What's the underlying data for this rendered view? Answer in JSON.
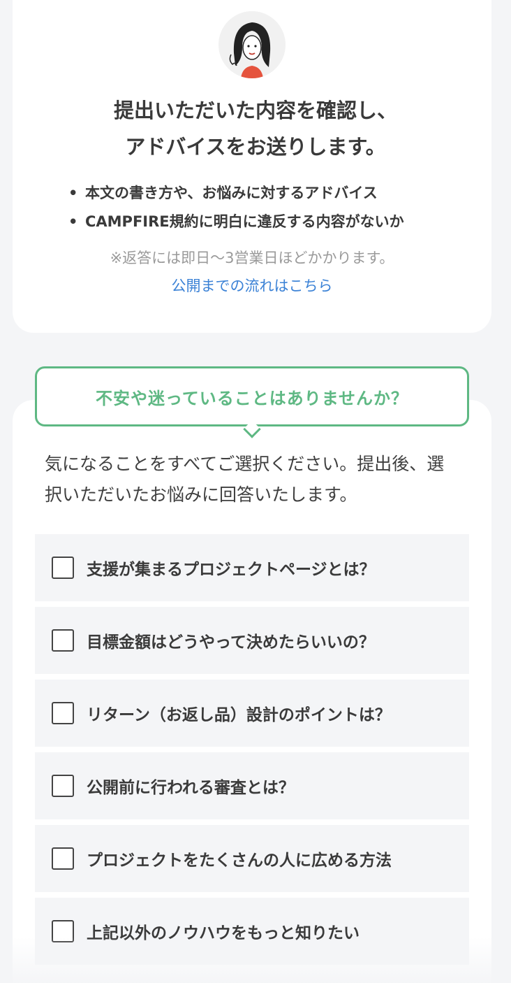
{
  "advice": {
    "headline_line1": "提出いただいた内容を確認し、",
    "headline_line2": "アドバイスをお送りします。",
    "bullets": [
      "本文の書き方や、お悩みに対するアドバイス",
      "CAMPFIRE規約に明白に違反する内容がないか"
    ],
    "note": "※返答には即日〜3営業日ほどかかります。",
    "flow_link": "公開までの流れはこちら"
  },
  "survey": {
    "bubble_title": "不安や迷っていることはありませんか？",
    "intro": "気になることをすべてご選択ください。提出後、選択いただいたお悩みに回答いたします。",
    "options": [
      "支援が集まるプロジェクトページとは？",
      "目標金額はどうやって決めたらいいの？",
      "リターン（お返し品）設計のポイントは？",
      "公開前に行われる審査とは？",
      "プロジェクトをたくさんの人に広める方法",
      "上記以外のノウハウをもっと知りたい"
    ]
  },
  "colors": {
    "accent_green": "#5eb883",
    "link_blue": "#3b82d6",
    "background": "#f4f5f7"
  }
}
